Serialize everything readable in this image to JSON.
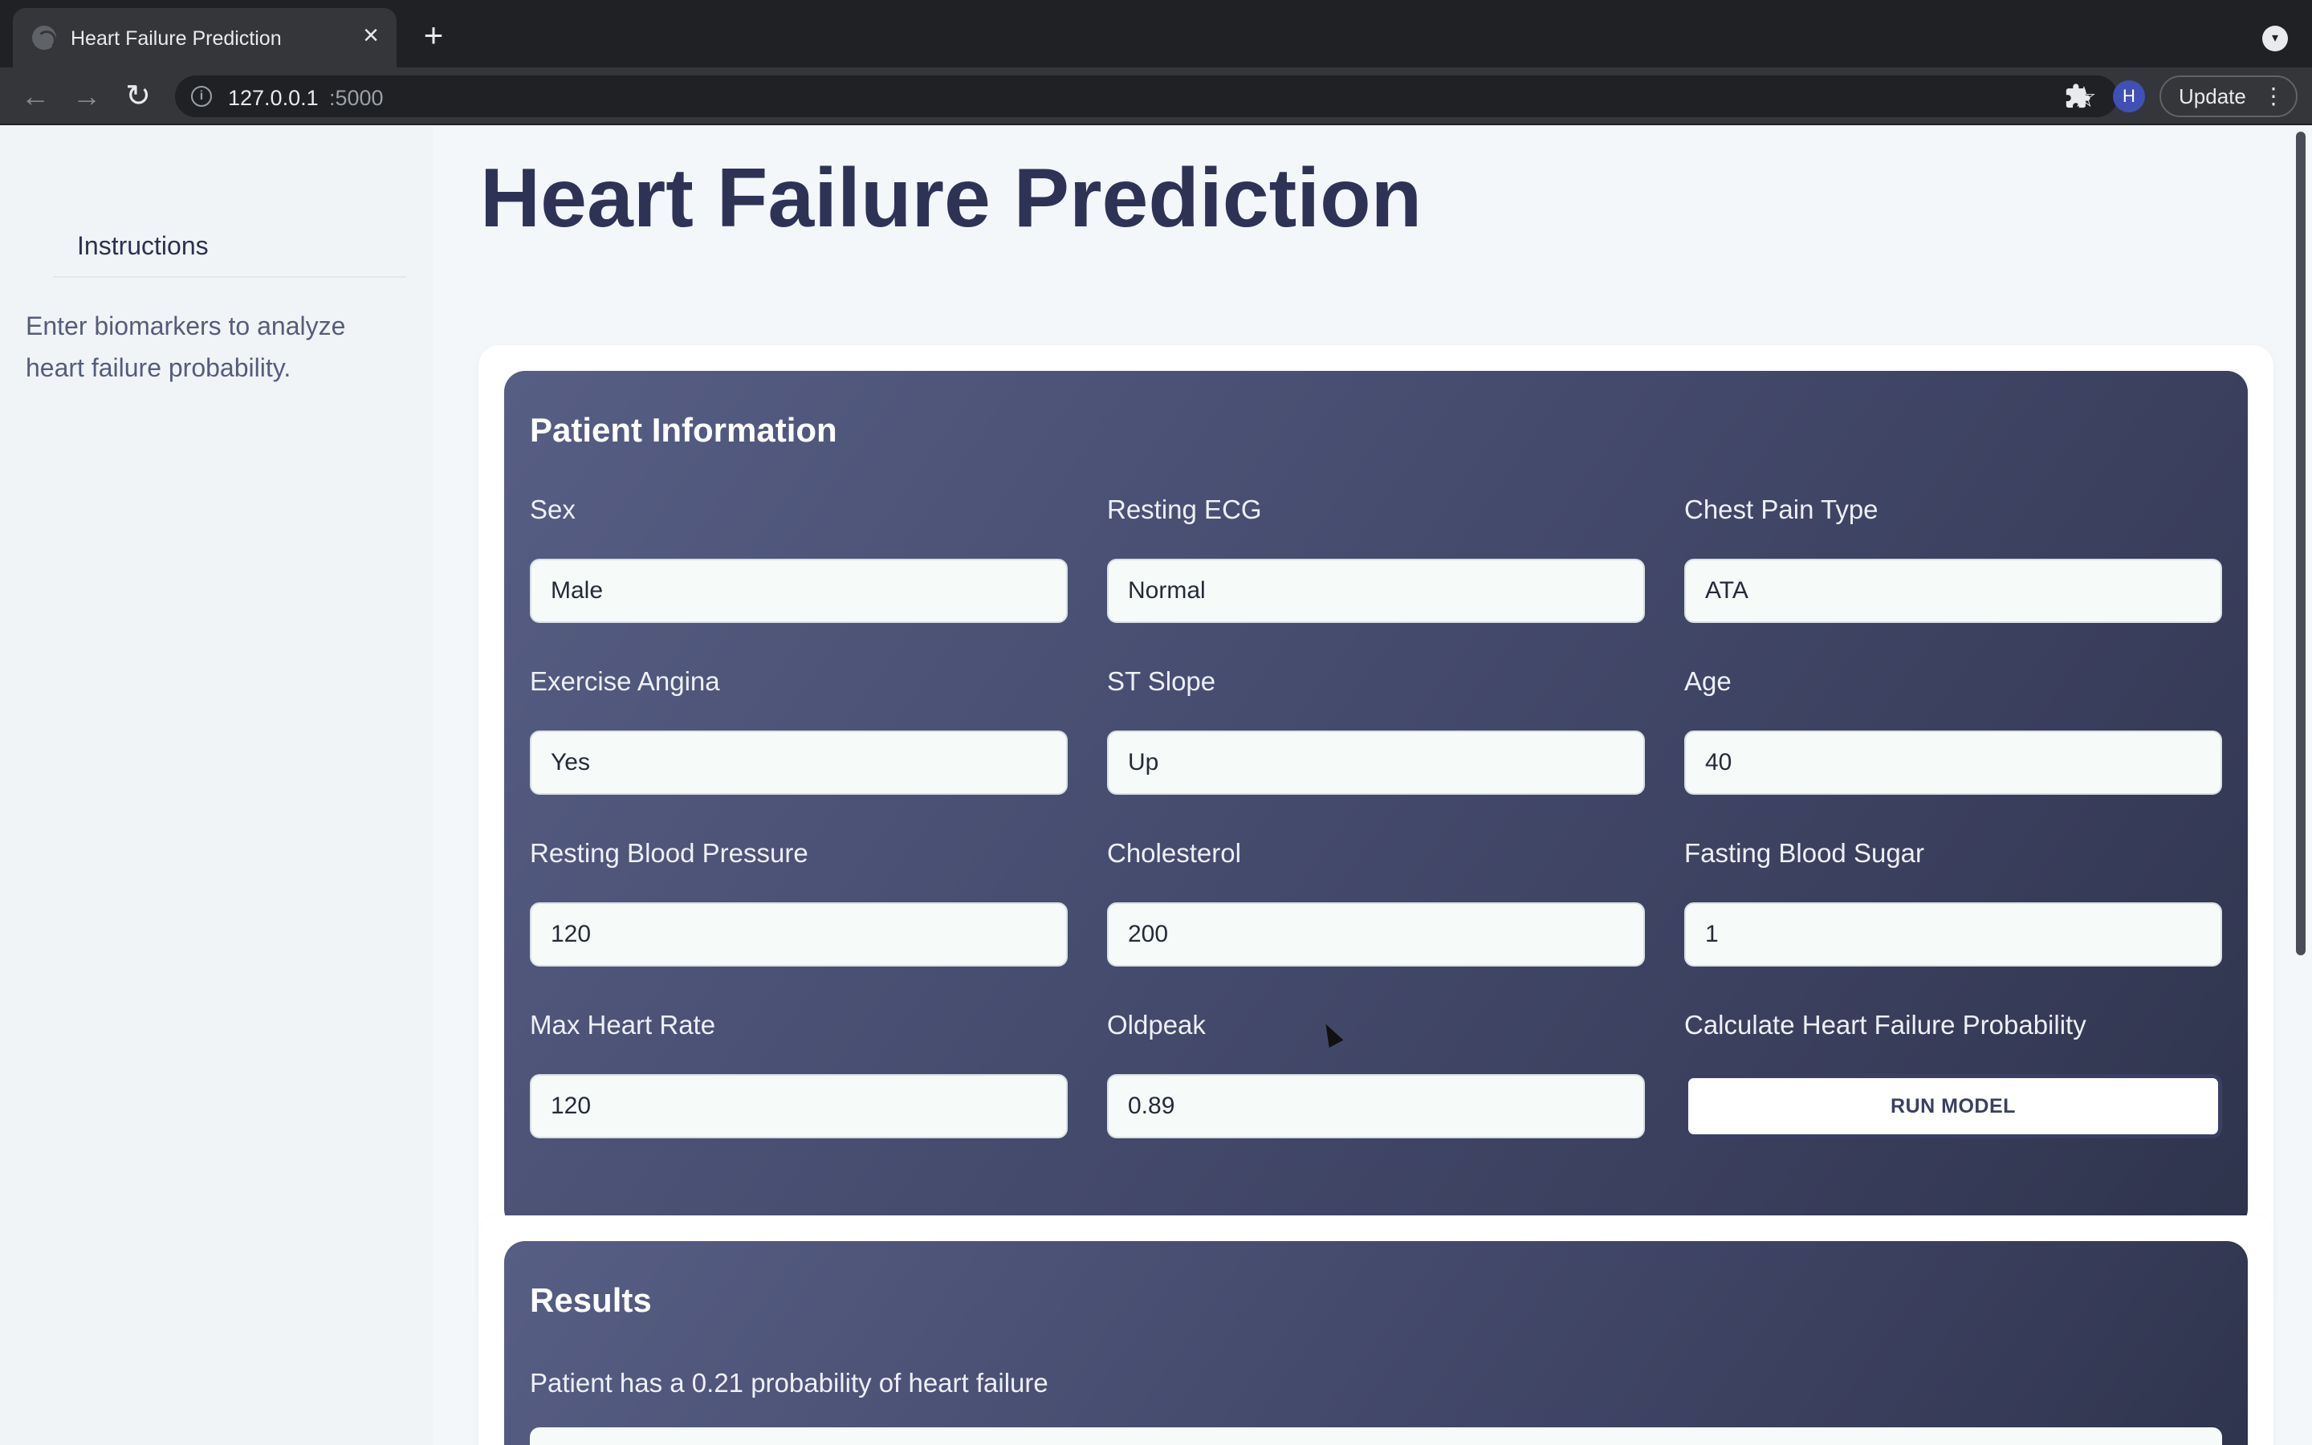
{
  "browser": {
    "tab_title": "Heart Failure Prediction",
    "url_host": "127.0.0.1",
    "url_port": ":5000",
    "avatar_initial": "H",
    "update_label": "Update"
  },
  "sidebar": {
    "heading": "Instructions",
    "text": "Enter biomarkers to analyze heart failure probability."
  },
  "page": {
    "title": "Heart Failure Prediction"
  },
  "patient_info": {
    "title": "Patient Information",
    "fields": [
      {
        "label": "Sex",
        "value": "Male"
      },
      {
        "label": "Resting ECG",
        "value": "Normal"
      },
      {
        "label": "Chest Pain Type",
        "value": "ATA"
      },
      {
        "label": "Exercise Angina",
        "value": "Yes"
      },
      {
        "label": "ST Slope",
        "value": "Up"
      },
      {
        "label": "Age",
        "value": "40"
      },
      {
        "label": "Resting Blood Pressure",
        "value": "120"
      },
      {
        "label": "Cholesterol",
        "value": "200"
      },
      {
        "label": "Fasting Blood Sugar",
        "value": "1"
      },
      {
        "label": "Max Heart Rate",
        "value": "120"
      },
      {
        "label": "Oldpeak",
        "value": "0.89"
      }
    ],
    "calculate_label": "Calculate Heart Failure Probability",
    "run_button": "RUN MODEL"
  },
  "results": {
    "title": "Results",
    "text": "Patient has a 0.21 probability of heart failure"
  }
}
